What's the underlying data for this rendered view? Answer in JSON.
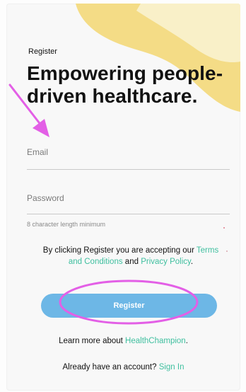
{
  "colors": {
    "accent_blob": "#f4dc86",
    "link": "#3fbf9f",
    "button": "#6db7e6",
    "annotation": "#e35fe6"
  },
  "header": {
    "small_title": "Register",
    "hero_line1": "Empowering people-",
    "hero_line2": "driven healthcare."
  },
  "form": {
    "email_placeholder": "Email",
    "password_placeholder": "Password",
    "password_hint": "8 character length minimum"
  },
  "consent": {
    "prefix": "By clicking Register you are accepting our ",
    "terms_link": "Terms and Conditions",
    "middle": " and ",
    "privacy_link": "Privacy Policy",
    "suffix": "."
  },
  "register_button": {
    "label": "Register"
  },
  "learn_more": {
    "prefix": "Learn more about ",
    "link": "HealthChampion",
    "suffix": "."
  },
  "sign_in": {
    "prefix": "Already have an account? ",
    "link": "Sign In"
  },
  "annotations": {
    "arrow_icon": "arrow-down-right-icon",
    "circle": "highlight-ellipse"
  }
}
